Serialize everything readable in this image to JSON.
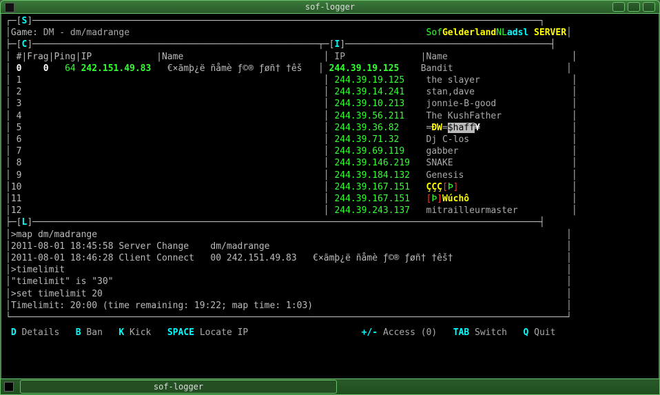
{
  "window": {
    "title": "sof-logger"
  },
  "taskbar": {
    "label": "sof-logger"
  },
  "tags": {
    "S": "S",
    "C": "C",
    "I": "I",
    "L": "L"
  },
  "game_line": {
    "prefix": "Game: ",
    "value": "DM - dm/madrange"
  },
  "server_name_parts": [
    {
      "t": "Sof",
      "c": "green"
    },
    {
      "t": "Gelderland",
      "c": "yellow-b"
    },
    {
      "t": "NL",
      "c": "green"
    },
    {
      "t": "adsl",
      "c": "cyan-b"
    },
    {
      "t": " SERVER",
      "c": "yellow-b"
    }
  ],
  "left_header": " #|Frag|Ping|IP            |Name",
  "right_header_ip": "IP",
  "right_header_name": "Name",
  "left_rows": [
    {
      "idx": "0",
      "frag": "0",
      "ping": "64",
      "ip": "242.151.49.83",
      "name": "€×ãmþ¿ë ñåmè ƒ©® ƒøñ† †êš"
    }
  ],
  "left_empty_idx": [
    "1",
    "2",
    "3",
    "4",
    "5",
    "6",
    "7",
    "8",
    "9",
    "10",
    "11",
    "12"
  ],
  "right_rows": [
    {
      "ip": "244.39.19.125",
      "bold": true,
      "name_parts": [
        {
          "t": "Bandit",
          "c": "gray"
        }
      ]
    },
    {
      "ip": "244.39.19.125",
      "name_parts": [
        {
          "t": "the slayer",
          "c": "gray"
        }
      ]
    },
    {
      "ip": "244.39.14.241",
      "name_parts": [
        {
          "t": "stan,dave",
          "c": "gray"
        }
      ]
    },
    {
      "ip": "244.39.10.213",
      "name_parts": [
        {
          "t": "jonnie-B-good",
          "c": "gray"
        }
      ]
    },
    {
      "ip": "244.39.56.211",
      "name_parts": [
        {
          "t": "The KushFather",
          "c": "gray"
        }
      ]
    },
    {
      "ip": "244.39.36.82",
      "name_parts": [
        {
          "t": "=",
          "c": "gray"
        },
        {
          "t": "ÐW",
          "c": "yellow-b"
        },
        {
          "t": "=",
          "c": "gray"
        },
        {
          "t": "$haff",
          "c": "inv"
        },
        {
          "t": "¥",
          "c": "white-b"
        }
      ]
    },
    {
      "ip": "244.39.71.32",
      "name_parts": [
        {
          "t": "Dj C-los",
          "c": "gray"
        }
      ]
    },
    {
      "ip": "244.39.69.119",
      "name_parts": [
        {
          "t": "gabber",
          "c": "gray"
        }
      ]
    },
    {
      "ip": "244.39.146.219",
      "name_parts": [
        {
          "t": "SNAKE",
          "c": "gray"
        }
      ]
    },
    {
      "ip": "244.39.184.132",
      "name_parts": [
        {
          "t": "Genesis",
          "c": "gray"
        }
      ]
    },
    {
      "ip": "244.39.167.151",
      "name_parts": [
        {
          "t": "ÇÇÇ",
          "c": "yellow-b"
        },
        {
          "t": "[",
          "c": "red"
        },
        {
          "t": "Þ",
          "c": "green"
        },
        {
          "t": "]",
          "c": "red"
        }
      ]
    },
    {
      "ip": "244.39.167.151",
      "name_parts": [
        {
          "t": "[",
          "c": "red"
        },
        {
          "t": "Þ",
          "c": "green"
        },
        {
          "t": "]",
          "c": "red"
        },
        {
          "t": "Wúchô",
          "c": "yellow-b"
        }
      ]
    },
    {
      "ip": "244.39.243.137",
      "name_parts": [
        {
          "t": "mitrailleurmaster",
          "c": "gray"
        }
      ]
    }
  ],
  "log_lines": [
    ">map dm/madrange",
    "2011-08-01 18:45:58 Server Change    dm/madrange",
    "2011-08-01 18:46:28 Client Connect   00 242.151.49.83   €×ãmþ¿ë ñåmè ƒ©® ƒøñ† †êš†",
    ">timelimit",
    "\"timelimit\" is \"30\"",
    ">set timelimit 20",
    "Timelimit: 20:00 (time remaining: 19:22; map time: 1:03)"
  ],
  "hotbar": {
    "items": [
      {
        "key": "D",
        "label": "Details"
      },
      {
        "key": "B",
        "label": "Ban"
      },
      {
        "key": "K",
        "label": "Kick"
      },
      {
        "key": "SPACE",
        "label": "Locate IP"
      }
    ],
    "right_items": [
      {
        "key": "+/-",
        "label": "Access (0)"
      },
      {
        "key": "TAB",
        "label": "Switch"
      },
      {
        "key": "Q",
        "label": "Quit"
      }
    ]
  }
}
